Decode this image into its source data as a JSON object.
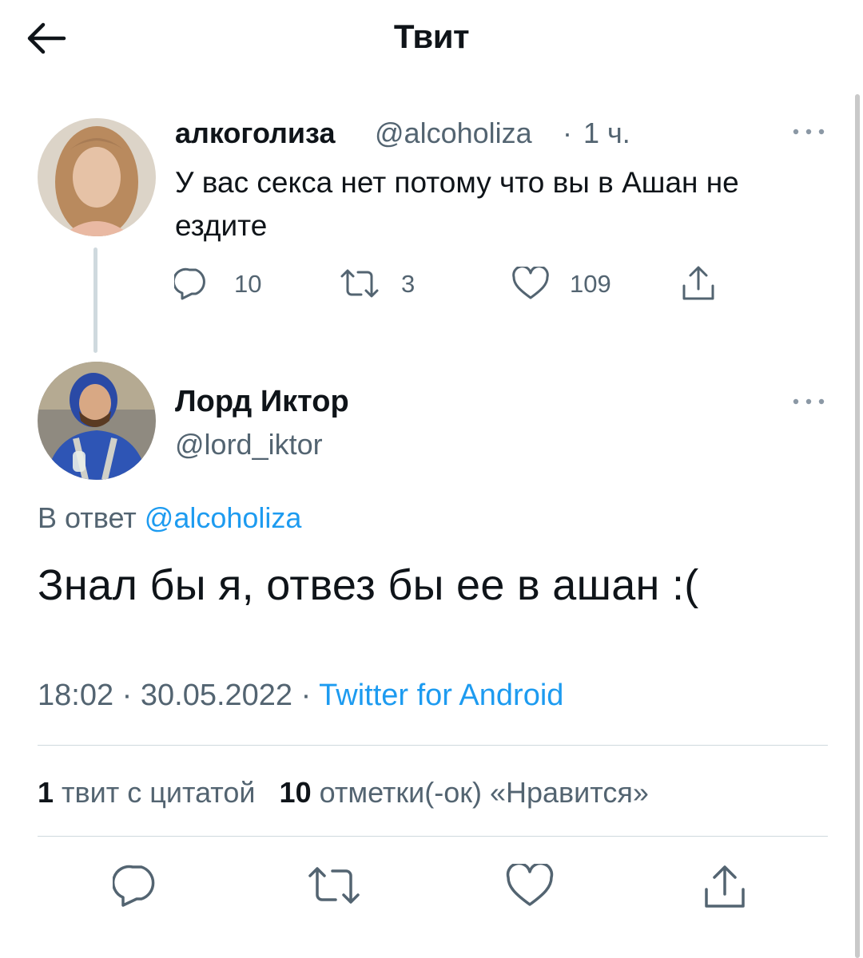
{
  "header": {
    "title": "Твит",
    "back_icon": "arrow-left-icon"
  },
  "parent_tweet": {
    "author_name": "алкоголиза",
    "handle": "@alcoholiza",
    "separator": "·",
    "time": "1 ч.",
    "text": "У вас секса нет потому что вы в Ашан не ездите",
    "replies": "10",
    "retweets": "3",
    "likes": "109",
    "icons": [
      "reply-icon",
      "retweet-icon",
      "like-icon",
      "share-icon",
      "more-icon"
    ]
  },
  "main_tweet": {
    "author_name": "Лорд Иктор",
    "handle": "@lord_iktor",
    "reply_prefix": "В ответ",
    "reply_to": "@alcoholiza",
    "text": "Знал бы я, отвез бы ее в ашан :(",
    "time": "18:02",
    "date": "30.05.2022",
    "source": "Twitter for Android",
    "quote_count": "1",
    "quote_label": "твит с цитатой",
    "like_count": "10",
    "like_label": "отметки(-ок) «Нравится»"
  },
  "colors": {
    "text": "#0f1419",
    "secondary": "#536471",
    "link": "#1d9bf0",
    "divider": "#cfd9de"
  }
}
